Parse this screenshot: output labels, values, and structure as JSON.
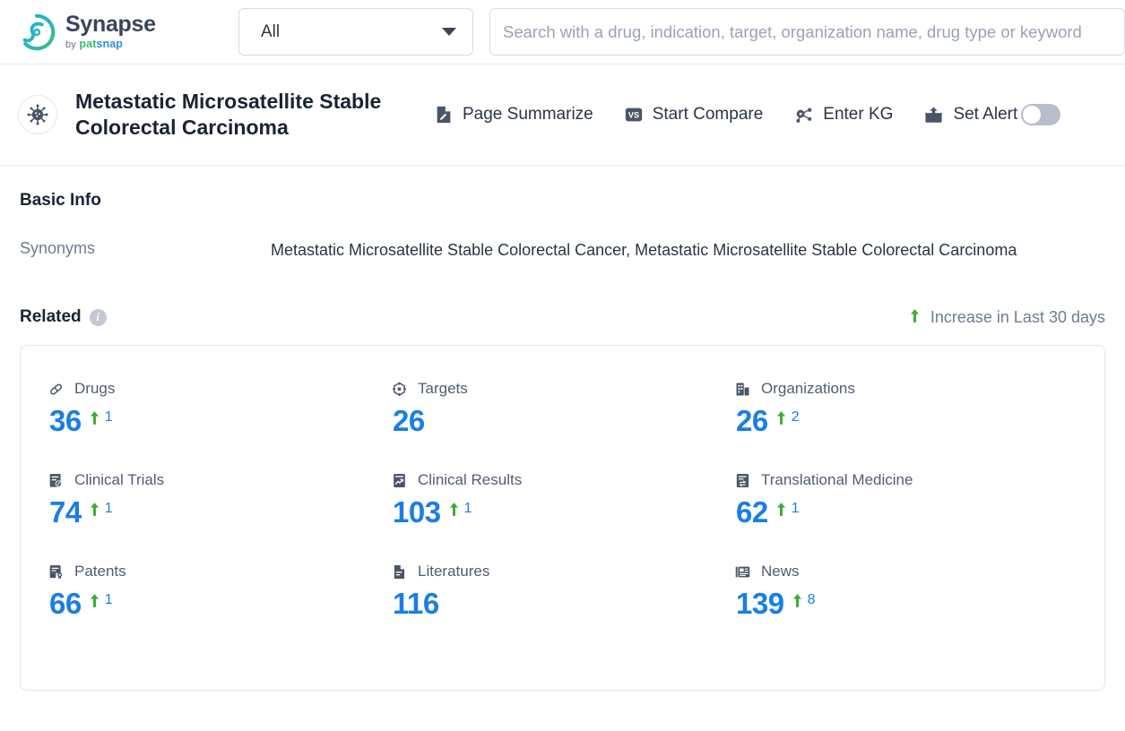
{
  "brand": {
    "name": "Synapse",
    "by": "by",
    "pat": "pat",
    "snap": "snap"
  },
  "topbar": {
    "scope_value": "All",
    "search_placeholder": "Search with a drug, indication, target, organization name, drug type or keyword",
    "search_value": ""
  },
  "entity": {
    "title": "Metastatic Microsatellite Stable Colorectal Carcinoma",
    "actions": [
      {
        "label": "Page Summarize",
        "icon": "document-pen-icon"
      },
      {
        "label": "Start Compare",
        "icon": "vs-badge-icon"
      },
      {
        "label": "Enter KG",
        "icon": "knowledge-graph-icon"
      },
      {
        "label": "Set Alert",
        "icon": "alert-envelope-icon"
      }
    ],
    "alert_toggle_on": false
  },
  "basic_info": {
    "title": "Basic Info",
    "synonyms_label": "Synonyms",
    "synonyms_value": "Metastatic Microsatellite Stable Colorectal Cancer,  Metastatic Microsatellite Stable Colorectal Carcinoma"
  },
  "related": {
    "title": "Related",
    "info_glyph": "i",
    "legend": "Increase in Last 30 days",
    "accent_blue": "#1a7ee5",
    "increase_green": "#3faa35",
    "stats": [
      {
        "label": "Drugs",
        "icon": "pill-icon",
        "value": "36",
        "delta": "1"
      },
      {
        "label": "Targets",
        "icon": "target-icon",
        "value": "26",
        "delta": ""
      },
      {
        "label": "Organizations",
        "icon": "building-icon",
        "value": "26",
        "delta": "2"
      },
      {
        "label": "Clinical Trials",
        "icon": "clinical-trial-icon",
        "value": "74",
        "delta": "1"
      },
      {
        "label": "Clinical Results",
        "icon": "clinical-result-icon",
        "value": "103",
        "delta": "1"
      },
      {
        "label": "Translational Medicine",
        "icon": "translational-medicine-icon",
        "value": "62",
        "delta": "1"
      },
      {
        "label": "Patents",
        "icon": "patent-icon",
        "value": "66",
        "delta": "1"
      },
      {
        "label": "Literatures",
        "icon": "literature-icon",
        "value": "116",
        "delta": ""
      },
      {
        "label": "News",
        "icon": "news-icon",
        "value": "139",
        "delta": "8"
      }
    ]
  }
}
